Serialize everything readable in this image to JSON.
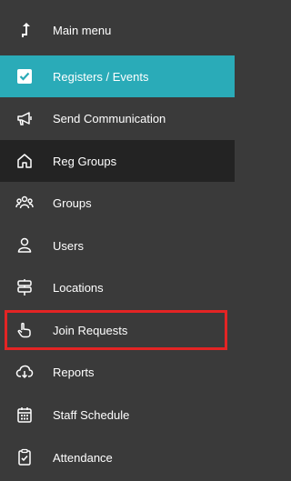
{
  "sidebar": {
    "items": [
      {
        "label": "Main menu",
        "icon": "arrow-up-icon"
      },
      {
        "label": "Registers / Events",
        "icon": "checkbox-icon",
        "active": true
      },
      {
        "label": "Send Communication",
        "icon": "megaphone-icon"
      },
      {
        "label": "Reg Groups",
        "icon": "home-icon"
      },
      {
        "label": "Groups",
        "icon": "people-icon"
      },
      {
        "label": "Users",
        "icon": "user-icon"
      },
      {
        "label": "Locations",
        "icon": "signpost-icon"
      },
      {
        "label": "Join Requests",
        "icon": "hand-pointer-icon",
        "highlighted": true
      },
      {
        "label": "Reports",
        "icon": "cloud-download-icon"
      },
      {
        "label": "Staff Schedule",
        "icon": "calendar-icon"
      },
      {
        "label": "Attendance",
        "icon": "clipboard-check-icon"
      }
    ]
  },
  "colors": {
    "background": "#3a3a3a",
    "active": "#2aabb8",
    "hover": "#232323",
    "highlight": "#e32424"
  }
}
